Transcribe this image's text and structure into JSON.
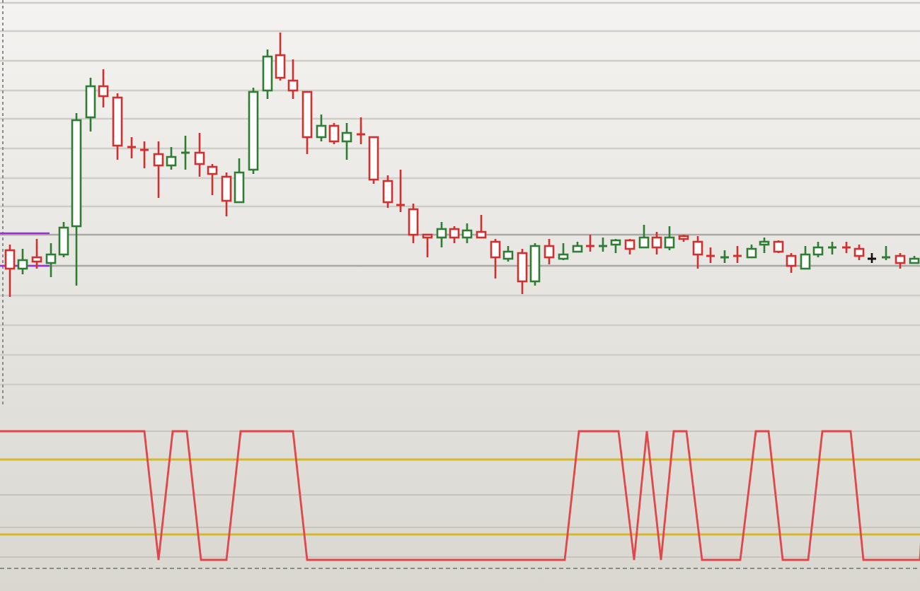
{
  "price_panel": {
    "kind": "candlestick"
  },
  "indicator_panel": {
    "kind": "oscillator"
  }
}
